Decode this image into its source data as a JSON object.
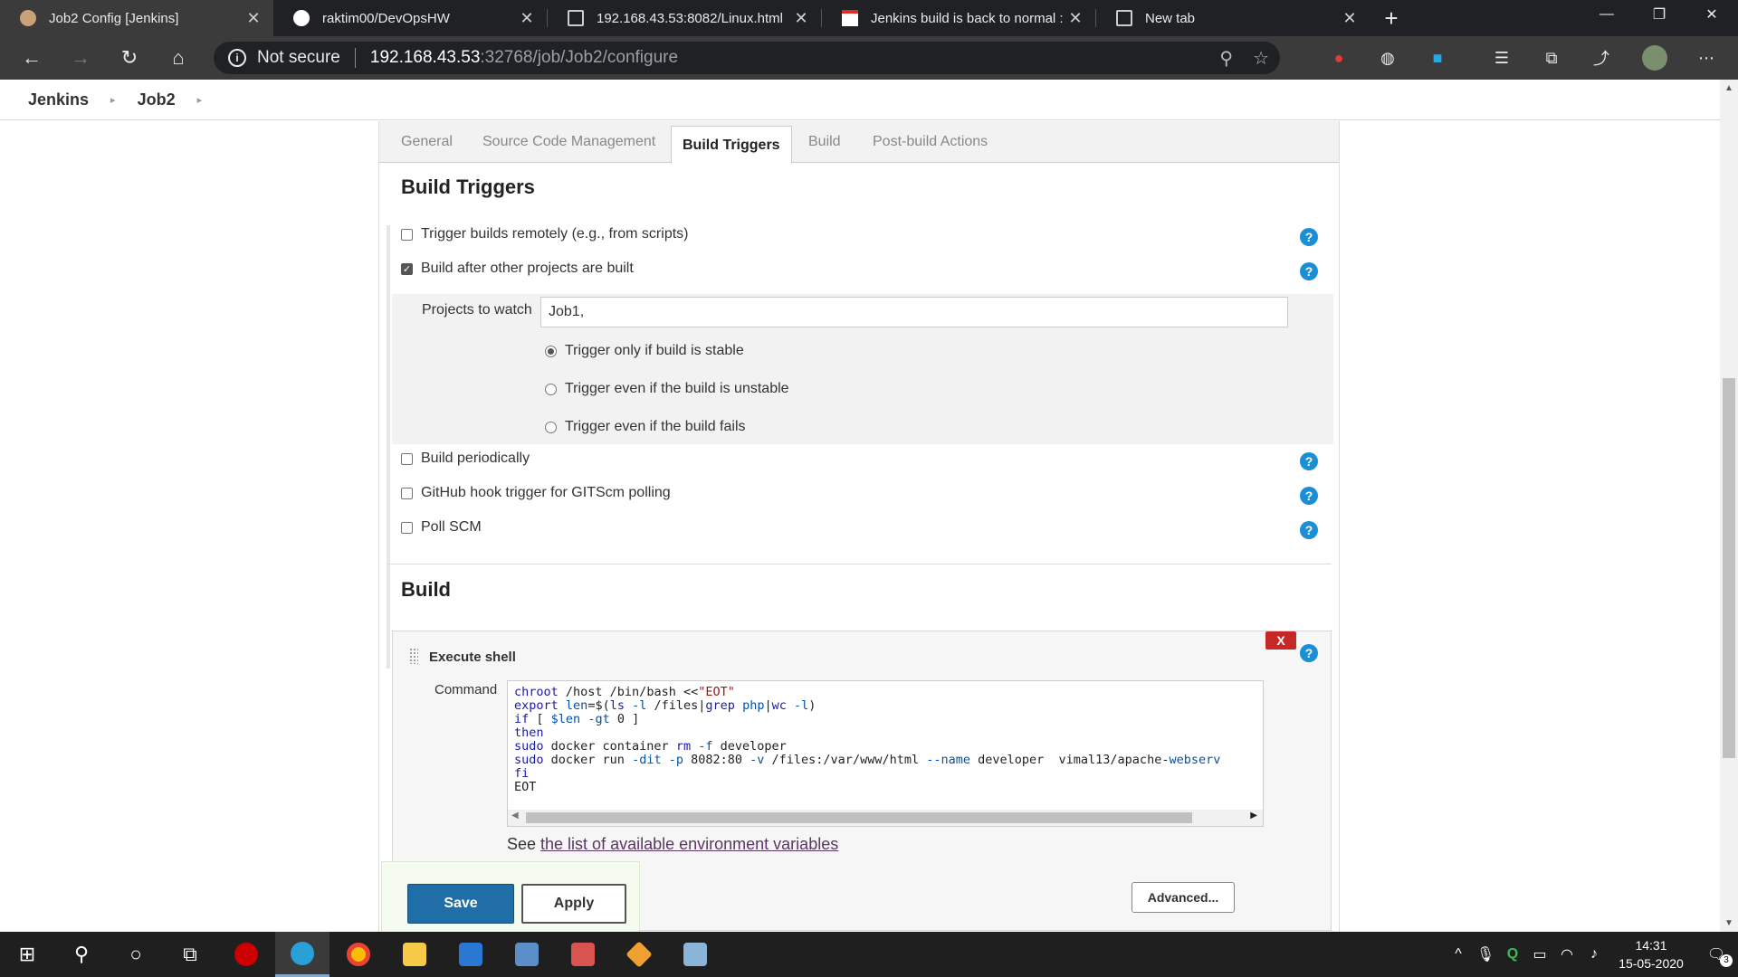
{
  "browser": {
    "tabs": [
      {
        "title": "Job2 Config [Jenkins]",
        "icon": "jenkins-icon",
        "active": true
      },
      {
        "title": "raktim00/DevOpsHW",
        "icon": "github-icon",
        "active": false
      },
      {
        "title": "192.168.43.53:8082/Linux.html",
        "icon": "page-icon",
        "active": false
      },
      {
        "title": "Jenkins build is back to normal :",
        "icon": "gmail-icon",
        "active": false
      },
      {
        "title": "New tab",
        "icon": "newtab-icon",
        "active": false
      }
    ],
    "security_label": "Not secure",
    "url_host": "192.168.43.53",
    "url_path": ":32768/job/Job2/configure"
  },
  "breadcrumb": {
    "items": [
      "Jenkins",
      "Job2"
    ]
  },
  "config_tabs": [
    "General",
    "Source Code Management",
    "Build Triggers",
    "Build",
    "Post-build Actions"
  ],
  "build_triggers": {
    "title": "Build Triggers",
    "options": [
      {
        "label": "Trigger builds remotely (e.g., from scripts)",
        "checked": false
      },
      {
        "label": "Build after other projects are built",
        "checked": true
      },
      {
        "label": "Build periodically",
        "checked": false
      },
      {
        "label": "GitHub hook trigger for GITScm polling",
        "checked": false
      },
      {
        "label": "Poll SCM",
        "checked": false
      }
    ],
    "projects_label": "Projects to watch",
    "projects_value": "Job1,",
    "radio_options": [
      {
        "label": "Trigger only if build is stable",
        "selected": true
      },
      {
        "label": "Trigger even if the build is unstable",
        "selected": false
      },
      {
        "label": "Trigger even if the build fails",
        "selected": false
      }
    ]
  },
  "build": {
    "title": "Build",
    "step_title": "Execute shell",
    "delete_label": "X",
    "command_label": "Command",
    "command_lines": [
      "chroot /host /bin/bash <<\"EOT\"",
      "export len=$(ls -l /files|grep php|wc -l)",
      "if [ $len -gt 0 ]",
      "then",
      "sudo docker container rm -f developer",
      "sudo docker run -dit -p 8082:80 -v /files:/var/www/html --name developer  vimal13/apache-webserv",
      "fi",
      "EOT"
    ],
    "env_prefix": "See ",
    "env_link": "the list of available environment variables",
    "advanced_label": "Advanced..."
  },
  "actions": {
    "save_label": "Save",
    "apply_label": "Apply"
  },
  "taskbar": {
    "time": "14:31",
    "date": "15-05-2020",
    "notifications": "3"
  },
  "colors": {
    "save_button": "#1f6ea8",
    "help_icon": "#1a8fd6",
    "delete_button": "#c62828",
    "link": "#5c3566"
  }
}
